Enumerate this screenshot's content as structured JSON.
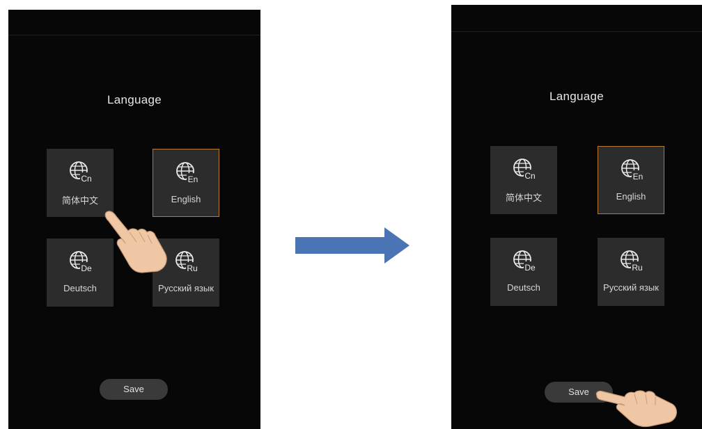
{
  "left_screen": {
    "title": "Language",
    "languages": [
      {
        "code": "Cn",
        "label": "简体中文",
        "selected": false
      },
      {
        "code": "En",
        "label": "English",
        "selected": true
      },
      {
        "code": "De",
        "label": "Deutsch",
        "selected": false
      },
      {
        "code": "Ru",
        "label": "Русский язык",
        "selected": false
      }
    ],
    "save_label": "Save"
  },
  "right_screen": {
    "title": "Language",
    "languages": [
      {
        "code": "Cn",
        "label": "简体中文",
        "selected": false
      },
      {
        "code": "En",
        "label": "English",
        "selected": true
      },
      {
        "code": "De",
        "label": "Deutsch",
        "selected": false
      },
      {
        "code": "Ru",
        "label": "Русский язык",
        "selected": false
      }
    ],
    "save_label": "Save"
  },
  "colors": {
    "screen_bg": "#070707",
    "tile_bg": "#2c2c2c",
    "selected_border": "#b87a2c",
    "arrow": "#4a74b4",
    "button_bg": "#3a3a3a"
  },
  "icons": {
    "language_tile": "globe-icon",
    "transition": "right-arrow-icon",
    "gesture": "pointing-hand-icon"
  }
}
